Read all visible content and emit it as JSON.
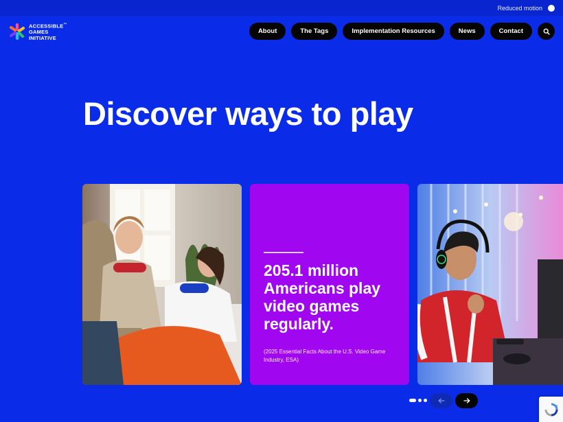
{
  "topbar": {
    "reduced_motion_label": "Reduced motion"
  },
  "logo": {
    "line1": "ACCESSIBLE",
    "line2": "GAMES",
    "line3": "INITIATIVE",
    "tm": "™"
  },
  "nav": {
    "items": [
      {
        "label": "About"
      },
      {
        "label": "The Tags"
      },
      {
        "label": "Implementation Resources"
      },
      {
        "label": "News"
      },
      {
        "label": "Contact"
      }
    ],
    "search_icon": "search-icon"
  },
  "hero": {
    "title": "Discover ways to play"
  },
  "carousel": {
    "stat_card": {
      "text": "205.1 million Americans play video games regularly.",
      "source": "(2025 Essential Facts About the U.S. Video Game Industry, ESA)"
    },
    "pager": {
      "total": 3,
      "active_index": 0
    },
    "prev_icon": "arrow-left-icon",
    "next_icon": "arrow-right-icon"
  },
  "colors": {
    "background": "#0a2ce8",
    "topbar": "#0925cf",
    "stat_card": "#a007f0",
    "nav_button": "#050505"
  }
}
